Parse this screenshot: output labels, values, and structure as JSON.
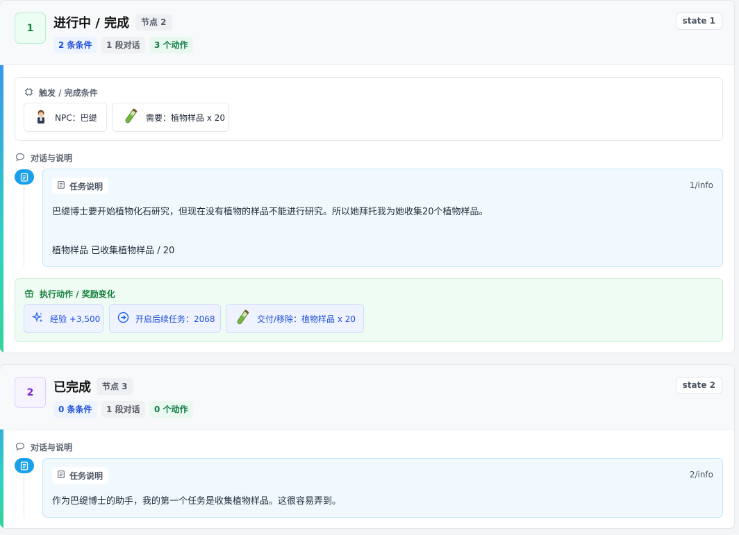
{
  "nodes": [
    {
      "number": "1",
      "title": "进行中 / 完成",
      "node_label": "节点 2",
      "state": "state 1",
      "stats": {
        "conditions": "2 条条件",
        "dialogs": "1 段对话",
        "actions": "3 个动作"
      },
      "conditions_section": {
        "title": "触发 / 完成条件",
        "items": [
          {
            "icon": "npc-portrait-icon",
            "label": "NPC：巴缇"
          },
          {
            "icon": "plant-sample-item-icon",
            "label": "需要：植物样品 x 20"
          }
        ]
      },
      "dialog_section": {
        "title": "对话与说明",
        "entries": [
          {
            "tag": "任务说明",
            "index": "1/info",
            "lines": [
              "巴缇博士要开始植物化石研究，但现在没有植物的样品不能进行研究。所以她拜托我为她收集20个植物样品。",
              "植物样品 已收集植物样品 / 20"
            ]
          }
        ]
      },
      "actions_section": {
        "title": "执行动作 / 奖励变化",
        "items": [
          {
            "icon": "sparkle-icon",
            "label": "经验 +3,500"
          },
          {
            "icon": "arrow-right-circle-icon",
            "label": "开启后续任务：2068"
          },
          {
            "icon": "plant-sample-item-icon",
            "label": "交付/移除：植物样品 x 20"
          }
        ]
      }
    },
    {
      "number": "2",
      "title": "已完成",
      "node_label": "节点 3",
      "state": "state 2",
      "stats": {
        "conditions": "0 条条件",
        "dialogs": "1 段对话",
        "actions": "0 个动作"
      },
      "dialog_section": {
        "title": "对话与说明",
        "entries": [
          {
            "tag": "任务说明",
            "index": "2/info",
            "lines": [
              "作为巴缇博士的助手，我的第一个任务是收集植物样品。这很容易弄到。"
            ]
          }
        ]
      }
    }
  ],
  "colors": {
    "accent_blue": "#3b82f6",
    "accent_green": "#34d399",
    "info_icon_blue": "#1aa0e8",
    "num_box_1_text": "#15803d",
    "num_box_2_text": "#7e22ce"
  }
}
